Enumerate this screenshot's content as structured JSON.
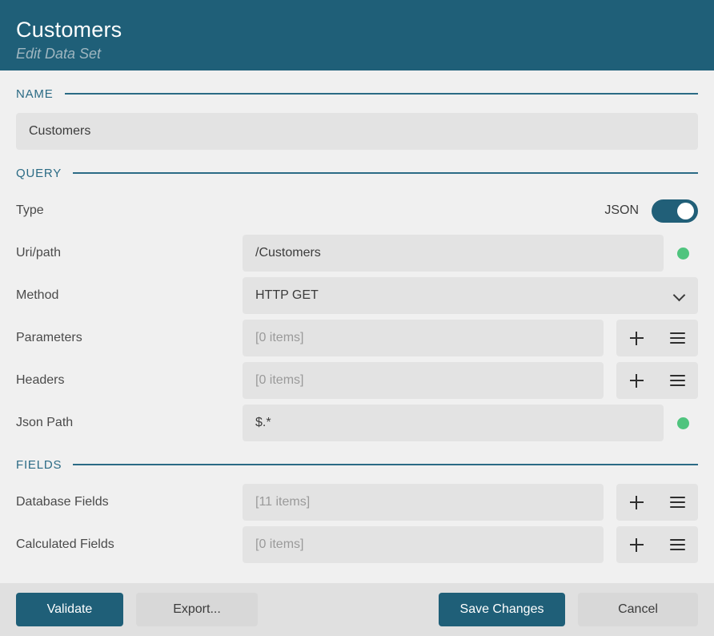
{
  "header": {
    "title": "Customers",
    "subtitle": "Edit Data Set"
  },
  "sections": {
    "name": {
      "label": "NAME",
      "value": "Customers"
    },
    "query": {
      "label": "QUERY",
      "type_row": {
        "label": "Type",
        "toggle_label": "JSON",
        "toggle_on": "on"
      },
      "uri_row": {
        "label": "Uri/path",
        "value": "/Customers",
        "status": "ok"
      },
      "method_row": {
        "label": "Method",
        "value": "HTTP GET"
      },
      "parameters_row": {
        "label": "Parameters",
        "placeholder": "[0 items]"
      },
      "headers_row": {
        "label": "Headers",
        "placeholder": "[0 items]"
      },
      "jsonpath_row": {
        "label": "Json Path",
        "value": "$.*",
        "status": "ok"
      }
    },
    "fields": {
      "label": "FIELDS",
      "database_fields_row": {
        "label": "Database Fields",
        "placeholder": "[11 items]"
      },
      "calculated_fields_row": {
        "label": "Calculated Fields",
        "placeholder": "[0 items]"
      }
    }
  },
  "footer": {
    "validate_label": "Validate",
    "export_label": "Export...",
    "save_label": "Save Changes",
    "cancel_label": "Cancel"
  },
  "colors": {
    "header_bg": "#1f5f78",
    "accent": "#2b6b85",
    "status_ok": "#4fc47e",
    "field_bg": "#e3e3e3",
    "page_bg": "#f0f0f0"
  }
}
